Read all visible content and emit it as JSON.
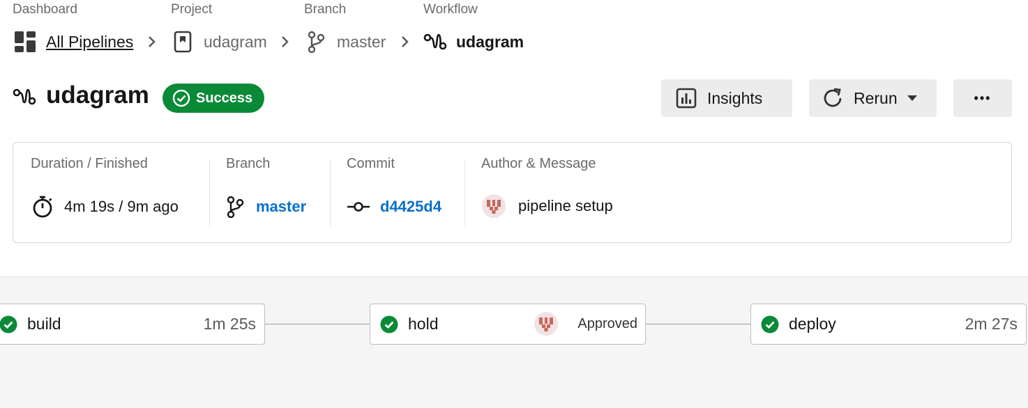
{
  "breadcrumb": {
    "labels": [
      "Dashboard",
      "Project",
      "Branch",
      "Workflow"
    ],
    "items": [
      {
        "text": "All Pipelines",
        "icon": "dashboard-icon"
      },
      {
        "text": "udagram",
        "icon": "project-icon"
      },
      {
        "text": "master",
        "icon": "branch-icon"
      },
      {
        "text": "udagram",
        "icon": "workflow-icon"
      }
    ]
  },
  "header": {
    "title": "udagram",
    "status": "Success",
    "status_color": "#0a8a37",
    "insights_label": "Insights",
    "rerun_label": "Rerun",
    "more_label": "•••"
  },
  "summary": {
    "duration_label": "Duration / Finished",
    "duration_value": "4m 19s / 9m ago",
    "branch_label": "Branch",
    "branch_value": "master",
    "commit_label": "Commit",
    "commit_value": "d4425d4",
    "author_label": "Author & Message",
    "message_value": "pipeline setup",
    "link_color": "#0a6fc9"
  },
  "jobs": [
    {
      "name": "build",
      "duration": "1m 25s",
      "status": "success"
    },
    {
      "name": "hold",
      "status_text": "Approved",
      "status": "success"
    },
    {
      "name": "deploy",
      "duration": "2m 27s",
      "status": "success"
    }
  ]
}
